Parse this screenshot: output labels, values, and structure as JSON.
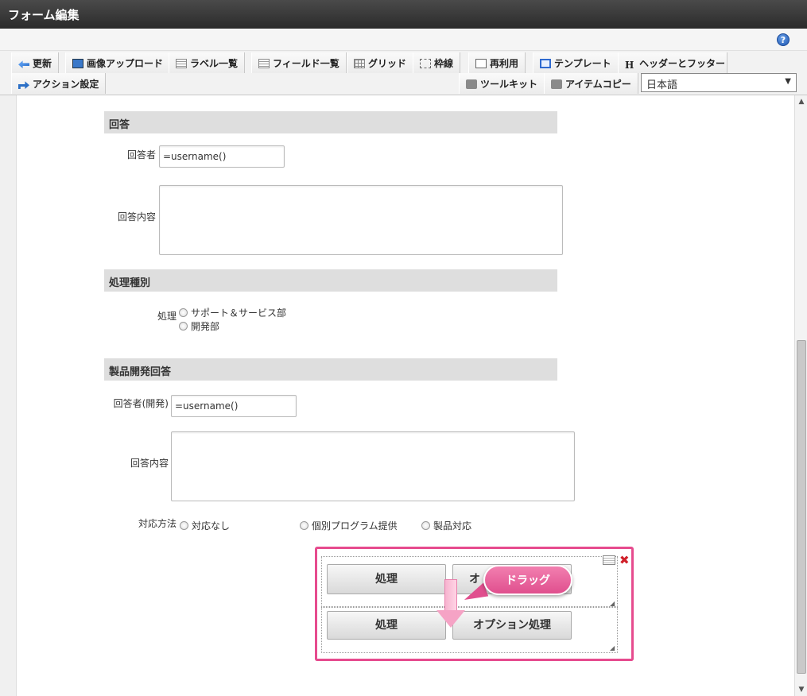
{
  "window": {
    "title": "フォーム編集"
  },
  "help": {
    "icon": "help-icon",
    "glyph": "?"
  },
  "toolbar": {
    "row1": [
      {
        "name": "update",
        "label": "更新",
        "icon": "update-icon"
      },
      {
        "name": "image-upload",
        "label": "画像アップロード",
        "icon": "image-icon"
      },
      {
        "name": "label-list",
        "label": "ラベル一覧",
        "icon": "list-icon"
      },
      {
        "name": "field-list",
        "label": "フィールド一覧",
        "icon": "list-icon"
      },
      {
        "name": "grid",
        "label": "グリッド",
        "icon": "grid-icon"
      },
      {
        "name": "frame-line",
        "label": "枠線",
        "icon": "frame-icon"
      },
      {
        "name": "reuse",
        "label": "再利用",
        "icon": "document-icon"
      },
      {
        "name": "template",
        "label": "テンプレート",
        "icon": "template-icon"
      },
      {
        "name": "header-footer",
        "label": "ヘッダーとフッター",
        "icon": "header-icon"
      }
    ],
    "row2": [
      {
        "name": "action-settings",
        "label": "アクション設定",
        "icon": "action-icon"
      },
      {
        "name": "toolkit",
        "label": "ツールキット",
        "icon": "toolbox-icon"
      },
      {
        "name": "item-copy",
        "label": "アイテムコピー",
        "icon": "toolbox-icon"
      }
    ],
    "language": {
      "selected": "日本語"
    }
  },
  "form": {
    "sections": [
      {
        "title": "回答"
      },
      {
        "title": "処理種別"
      },
      {
        "title": "製品開発回答"
      }
    ],
    "answer": {
      "respondent_label": "回答者",
      "respondent_value": "=username()",
      "content_label": "回答内容"
    },
    "process_type": {
      "label": "処理",
      "options": [
        "サポート＆サービス部",
        "開発部"
      ]
    },
    "dev_answer": {
      "respondent_label": "回答者(開発)",
      "respondent_value": "=username()",
      "content_label": "回答内容",
      "method_label": "対応方法",
      "method_options": [
        "対応なし",
        "個別プログラム提供",
        "製品対応"
      ]
    },
    "buttons": {
      "process": "処理",
      "option_process_partial": "オ",
      "option_process": "オプション処理"
    }
  },
  "annotation": {
    "drag_label": "ドラッグ"
  },
  "colors": {
    "accent": "#e64b8e",
    "titlebar": "#333333",
    "section": "#dedede"
  }
}
